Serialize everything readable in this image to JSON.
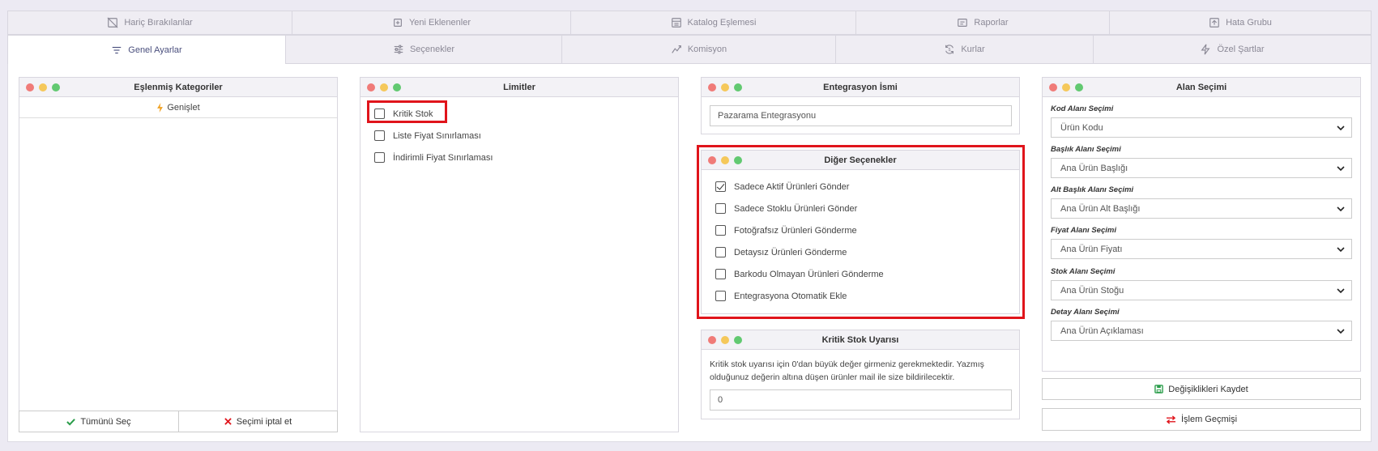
{
  "tabs_row1": [
    {
      "label": "Hariç Bırakılanlar",
      "icon": "excluded-icon"
    },
    {
      "label": "Yeni Eklenenler",
      "icon": "new-items-icon"
    },
    {
      "label": "Katalog Eşlemesi",
      "icon": "catalog-icon"
    },
    {
      "label": "Raporlar",
      "icon": "report-icon"
    },
    {
      "label": "Hata Grubu",
      "icon": "error-group-icon"
    }
  ],
  "tabs_row2": [
    {
      "label": "Genel Ayarlar",
      "icon": "filter-icon",
      "active": true
    },
    {
      "label": "Seçenekler",
      "icon": "sliders-icon"
    },
    {
      "label": "Komisyon",
      "icon": "commission-icon"
    },
    {
      "label": "Kurlar",
      "icon": "currency-icon"
    },
    {
      "label": "Özel Şartlar",
      "icon": "bolt-icon"
    }
  ],
  "categories": {
    "title": "Eşlenmiş Kategoriler",
    "expand_label": "Genişlet",
    "select_all_label": "Tümünü Seç",
    "cancel_label": "Seçimi iptal et"
  },
  "limits": {
    "title": "Limitler",
    "items": [
      {
        "label": "Kritik Stok",
        "checked": false
      },
      {
        "label": "Liste Fiyat Sınırlaması",
        "checked": false
      },
      {
        "label": "İndirimli Fiyat Sınırlaması",
        "checked": false
      }
    ]
  },
  "integration": {
    "title": "Entegrasyon İsmi",
    "value": "Pazarama  Entegrasyonu"
  },
  "other_options": {
    "title": "Diğer Seçenekler",
    "items": [
      {
        "label": "Sadece Aktif Ürünleri Gönder",
        "checked": true
      },
      {
        "label": "Sadece Stoklu Ürünleri Gönder",
        "checked": false
      },
      {
        "label": "Fotoğrafsız Ürünleri Gönderme",
        "checked": false
      },
      {
        "label": "Detaysız Ürünleri Gönderme",
        "checked": false
      },
      {
        "label": "Barkodu Olmayan Ürünleri Gönderme",
        "checked": false
      },
      {
        "label": "Entegrasyona Otomatik Ekle",
        "checked": false
      }
    ]
  },
  "critical_stock": {
    "title": "Kritik Stok Uyarısı",
    "description": "Kritik stok uyarısı için 0'dan büyük değer girmeniz gerekmektedir. Yazmış olduğunuz değerin altına düşen ürünler mail ile size bildirilecektir.",
    "value": "0"
  },
  "field_selection": {
    "title": "Alan Seçimi",
    "fields": [
      {
        "label": "Kod Alanı Seçimi",
        "value": "Ürün Kodu"
      },
      {
        "label": "Başlık Alanı Seçimi",
        "value": "Ana Ürün Başlığı"
      },
      {
        "label": "Alt Başlık Alanı Seçimi",
        "value": "Ana Ürün Alt Başlığı"
      },
      {
        "label": "Fiyat Alanı Seçimi",
        "value": "Ana Ürün Fiyatı"
      },
      {
        "label": "Stok Alanı Seçimi",
        "value": "Ana Ürün Stoğu"
      },
      {
        "label": "Detay Alanı Seçimi",
        "value": "Ana Ürün Açıklaması"
      }
    ]
  },
  "actions": {
    "save_label": "Değişiklikleri Kaydet",
    "history_label": "İşlem Geçmişi"
  },
  "colors": {
    "highlight": "#e0141b",
    "active_tab_text": "#4a4f7d",
    "save_icon": "#2a9d4a",
    "history_icon": "#e0141b",
    "bolt": "#f0a020"
  }
}
